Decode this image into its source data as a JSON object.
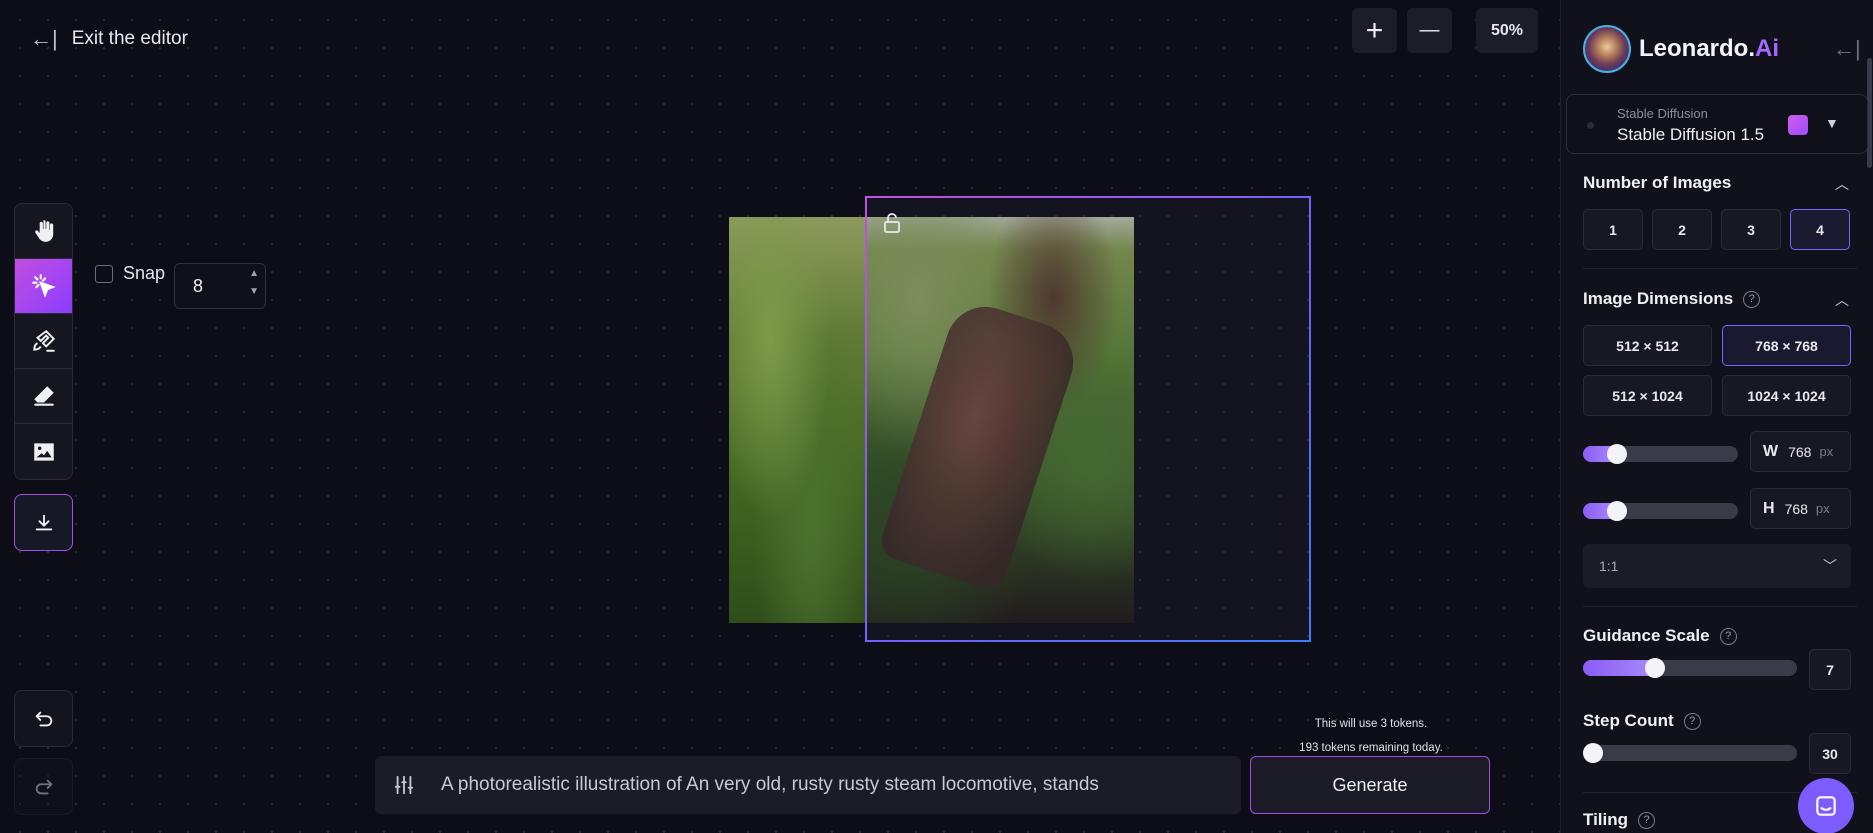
{
  "editor": {
    "exit_label": "Exit the editor",
    "zoom_in_label": "+",
    "zoom_out_label": "—",
    "zoom_level": "50%"
  },
  "snap": {
    "label": "Snap",
    "value": "8",
    "checked": false
  },
  "toolbar": {
    "tools": [
      {
        "name": "pan",
        "icon": "hand-icon"
      },
      {
        "name": "select",
        "icon": "cursor-click-icon",
        "active": true
      },
      {
        "name": "draw-mask",
        "icon": "paint-brush-icon"
      },
      {
        "name": "eraser",
        "icon": "eraser-icon"
      },
      {
        "name": "image",
        "icon": "image-icon"
      }
    ],
    "download_icon": "download-icon",
    "undo_icon": "undo-icon",
    "redo_icon": "redo-icon"
  },
  "prompt": {
    "text": "A photorealistic illustration of An very old, rusty rusty steam locomotive, stands",
    "settings_icon": "sliders-icon"
  },
  "generate": {
    "token_use": "This will use 3 tokens.",
    "tokens_remaining": "193 tokens remaining today.",
    "button_label": "Generate"
  },
  "panel": {
    "brand_name": "Leonardo.",
    "brand_suffix": "Ai",
    "model": {
      "family": "Stable Diffusion",
      "name": "Stable Diffusion 1.5"
    },
    "number_of_images": {
      "title": "Number of Images",
      "options": [
        "1",
        "2",
        "3",
        "4"
      ],
      "selected": "4"
    },
    "image_dimensions": {
      "title": "Image Dimensions",
      "help": "?",
      "options": [
        "512 × 512",
        "768 × 768",
        "512 × 1024",
        "1024 × 1024"
      ],
      "selected": "768 × 768",
      "width": {
        "key": "W",
        "value": "768",
        "unit": "px",
        "fraction": 0.18
      },
      "height": {
        "key": "H",
        "value": "768",
        "unit": "px",
        "fraction": 0.18
      },
      "aspect_ratio": "1:1"
    },
    "guidance_scale": {
      "title": "Guidance Scale",
      "help": "?",
      "value": "7",
      "fraction": 0.32
    },
    "step_count": {
      "title": "Step Count",
      "help": "?",
      "value": "30",
      "fraction": 0.0
    },
    "tiling": {
      "title": "Tiling",
      "help": "?"
    }
  },
  "colors": {
    "accent": "#8b5cf6",
    "accent_pink": "#c24fe0",
    "background": "#0d0d17",
    "panel": "#10111a"
  }
}
